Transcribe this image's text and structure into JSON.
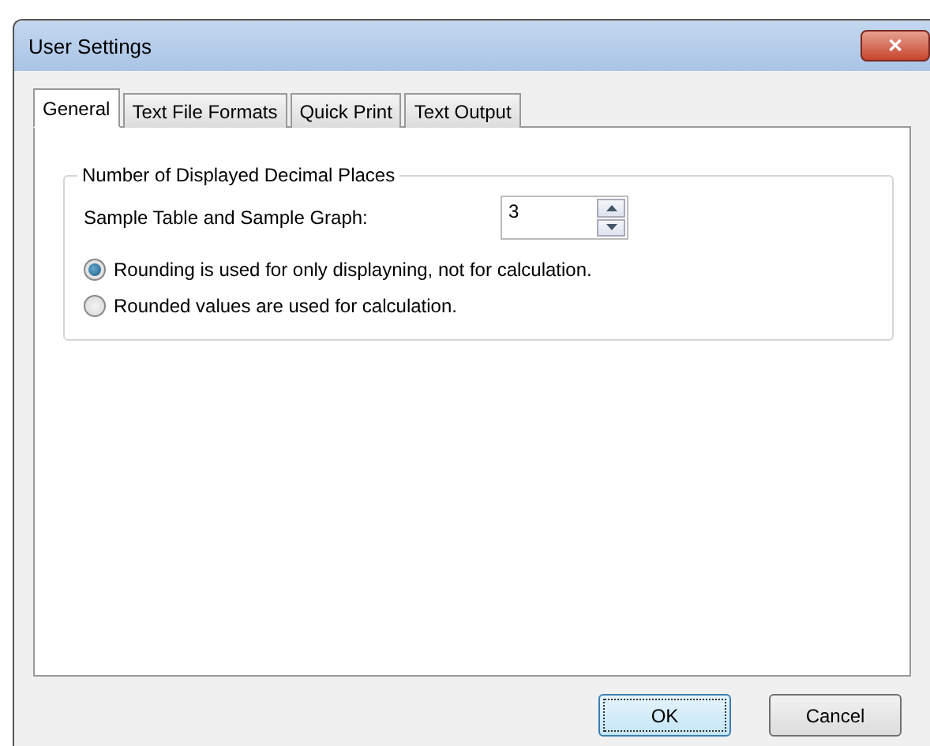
{
  "window": {
    "title": "User Settings",
    "close": "✕"
  },
  "tabs": [
    {
      "label": "General",
      "selected": true
    },
    {
      "label": "Text File Formats",
      "selected": false
    },
    {
      "label": "Quick Print",
      "selected": false
    },
    {
      "label": "Text Output",
      "selected": false
    }
  ],
  "group": {
    "title": "Number of Displayed Decimal Places",
    "spinner": {
      "label": "Sample Table and Sample Graph:",
      "value": "3"
    },
    "options": [
      {
        "label": "Rounding is used for only displayning, not for calculation.",
        "selected": true
      },
      {
        "label": "Rounded values are used for calculation.",
        "selected": false
      }
    ]
  },
  "buttons": [
    {
      "label": "OK",
      "default": true
    },
    {
      "label": "Cancel",
      "default": false
    }
  ]
}
